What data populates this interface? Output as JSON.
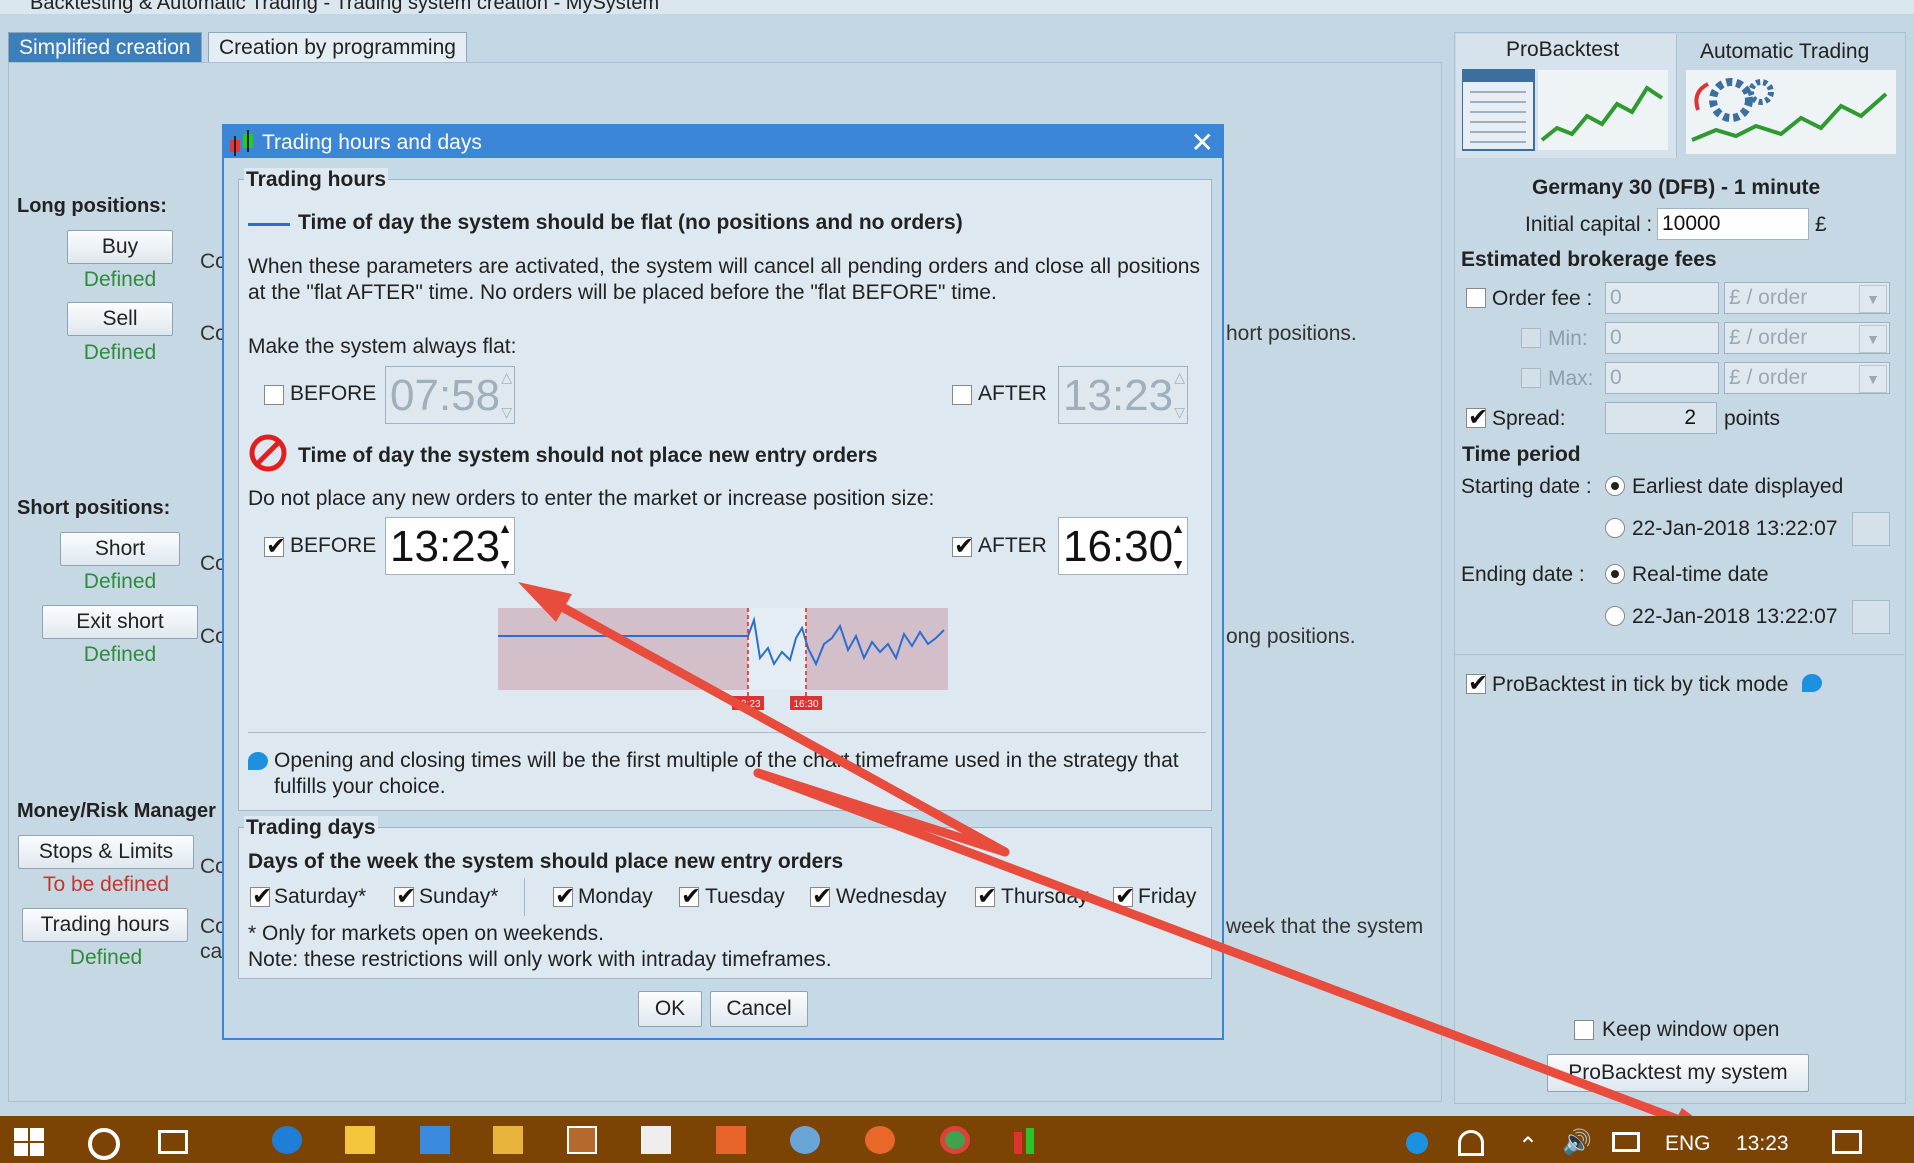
{
  "window": {
    "title": "Backtesting & Automatic Trading - Trading system creation - MySystem",
    "help_label": "?"
  },
  "tabs": [
    "Simplified creation",
    "Creation by programming"
  ],
  "left": {
    "long_label": "Long positions:",
    "buy_label": "Buy",
    "buy_status": "Defined",
    "sell_label": "Sell",
    "sell_status": "Defined",
    "short_label": "Short positions:",
    "short_btn": "Short",
    "short_status": "Defined",
    "exit_short_btn": "Exit short",
    "exit_short_status": "Defined",
    "money_label": "Money/Risk Manager",
    "stops_btn": "Stops & Limits",
    "stops_status": "To be defined",
    "hours_btn": "Trading hours",
    "hours_status": "Defined",
    "co": "Co",
    "ca": "ca",
    "snippet1": "hort positions.",
    "snippet2": "ong positions.",
    "snippet3": "week that the system"
  },
  "right": {
    "tab_probacktest": "ProBacktest",
    "tab_auto": "Automatic Trading",
    "instrument": "Germany 30 (DFB) - 1 minute",
    "capital_label": "Initial capital :",
    "capital_value": "10000",
    "currency": "£",
    "fees_title": "Estimated brokerage fees",
    "order_fee_label": "Order fee :",
    "min_label": "Min:",
    "max_label": "Max:",
    "fee_value": "0",
    "fee_unit": "£ / order",
    "spread_label": "Spread:",
    "spread_value": "2",
    "spread_unit": "points",
    "period_title": "Time period",
    "start_label": "Starting date :",
    "start_option": "Earliest date displayed",
    "start_date": "22-Jan-2018 13:22:07",
    "end_label": "Ending date :",
    "end_option": "Real-time date",
    "end_date": "22-Jan-2018 13:22:07",
    "tick_label": "ProBacktest in tick by tick mode",
    "keep_open": "Keep window open",
    "run_btn": "ProBacktest my system"
  },
  "dialog": {
    "title": "Trading hours and days",
    "hours_group": "Trading hours",
    "flat_heading": "Time of day the system should be flat (no positions and no orders)",
    "flat_desc": "When these parameters are activated, the system will cancel all pending orders and close all positions at the \"flat AFTER\" time. No orders will be placed before the \"flat BEFORE\" time.",
    "always_flat": "Make the system always flat:",
    "before_label": "BEFORE",
    "after_label": "AFTER",
    "flat_before_time": "07:58",
    "flat_after_time": "13:23",
    "noentry_heading": "Time of day the system should not place new entry orders",
    "noentry_desc": "Do not place any new orders to enter the market or increase position size:",
    "entry_before_time": "13:23",
    "entry_after_time": "16:30",
    "marker1": "13:23",
    "marker2": "16:30",
    "note": "Opening and closing times will be the first multiple of the chart timeframe used in the strategy that fulfills your choice.",
    "days_group": "Trading days",
    "days_heading": "Days of the week the system should place new entry orders",
    "days": [
      "Saturday*",
      "Sunday*",
      "Monday",
      "Tuesday",
      "Wednesday",
      "Thursday",
      "Friday"
    ],
    "weekend_note": "* Only for markets open on weekends.",
    "intraday_note": "Note: these restrictions will only work with intraday timeframes.",
    "ok": "OK",
    "cancel": "Cancel",
    "accent": "#3c86d8"
  },
  "taskbar": {
    "lang": "ENG",
    "time": "13:23",
    "color": "#7b4405"
  }
}
